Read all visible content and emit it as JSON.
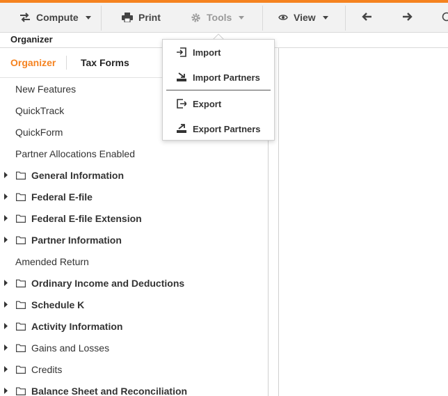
{
  "toolbar": {
    "compute": {
      "label": "Compute",
      "icon": "swap-arrows-icon"
    },
    "print": {
      "label": "Print",
      "icon": "printer-icon"
    },
    "tools": {
      "label": "Tools",
      "icon": "gear-icon"
    },
    "view": {
      "label": "View",
      "icon": "eye-icon"
    },
    "back_icon": "arrow-left-icon",
    "forward_icon": "arrow-right-icon"
  },
  "header": {
    "title": "Organizer"
  },
  "tabs": [
    {
      "label": "Organizer",
      "active": true
    },
    {
      "label": "Tax Forms",
      "active": false
    }
  ],
  "tree": [
    {
      "label": "New Features",
      "type": "item",
      "bold": false
    },
    {
      "label": "QuickTrack",
      "type": "item",
      "bold": false
    },
    {
      "label": "QuickForm",
      "type": "item",
      "bold": false
    },
    {
      "label": "Partner Allocations Enabled",
      "type": "item",
      "bold": false
    },
    {
      "label": "General Information",
      "type": "folder",
      "bold": true
    },
    {
      "label": "Federal E-file",
      "type": "folder",
      "bold": true
    },
    {
      "label": "Federal E-file Extension",
      "type": "folder",
      "bold": true
    },
    {
      "label": "Partner Information",
      "type": "folder",
      "bold": true
    },
    {
      "label": "Amended Return",
      "type": "item",
      "bold": false
    },
    {
      "label": "Ordinary Income and Deductions",
      "type": "folder",
      "bold": true
    },
    {
      "label": "Schedule K",
      "type": "folder",
      "bold": true
    },
    {
      "label": "Activity Information",
      "type": "folder",
      "bold": true
    },
    {
      "label": "Gains and Losses",
      "type": "folder",
      "bold": false
    },
    {
      "label": "Credits",
      "type": "folder",
      "bold": false
    },
    {
      "label": "Balance Sheet and Reconciliation",
      "type": "folder",
      "bold": true
    }
  ],
  "tools_menu": {
    "items": [
      {
        "label": "Import",
        "icon": "import-icon"
      },
      {
        "label": "Import Partners",
        "icon": "import-partners-icon"
      },
      {
        "label": "Export",
        "icon": "export-icon"
      },
      {
        "label": "Export Partners",
        "icon": "export-partners-icon"
      }
    ]
  },
  "colors": {
    "accent": "#f5821f",
    "toolbar_bg": "#f2f2f2",
    "disabled": "#999999"
  }
}
